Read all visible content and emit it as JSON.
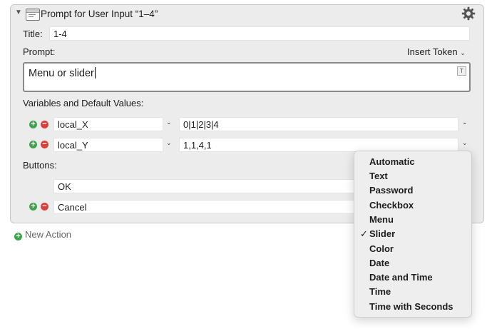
{
  "action": {
    "title": "Prompt for User Input “1–4”",
    "title_label": "Title:",
    "title_value": "1-4",
    "prompt_label": "Prompt:",
    "insert_token": "Insert Token",
    "prompt_text": "Menu or slider",
    "prompt_badge": "T"
  },
  "variables": {
    "label": "Variables and Default Values:",
    "rows": [
      {
        "name": "local_X",
        "default": "0|1|2|3|4"
      },
      {
        "name": "local_Y",
        "default": "1,1,4,1"
      }
    ]
  },
  "buttons": {
    "label": "Buttons:",
    "items": [
      "OK",
      "Cancel"
    ]
  },
  "new_action": "New Action",
  "type_menu": {
    "items": [
      "Automatic",
      "Text",
      "Password",
      "Checkbox",
      "Menu",
      "Slider",
      "Color",
      "Date",
      "Date and Time",
      "Time",
      "Time with Seconds"
    ],
    "selected": "Slider",
    "check": "✓"
  },
  "icons": {
    "disclosure": "disclosure-triangle-down",
    "app": "window-icon",
    "gear": "gear-icon",
    "chevron": "chevron-down",
    "add": "plus-circle",
    "remove": "minus-circle"
  },
  "colors": {
    "add": "#3fa34d",
    "remove": "#d9413b",
    "panel": "#ececec"
  }
}
